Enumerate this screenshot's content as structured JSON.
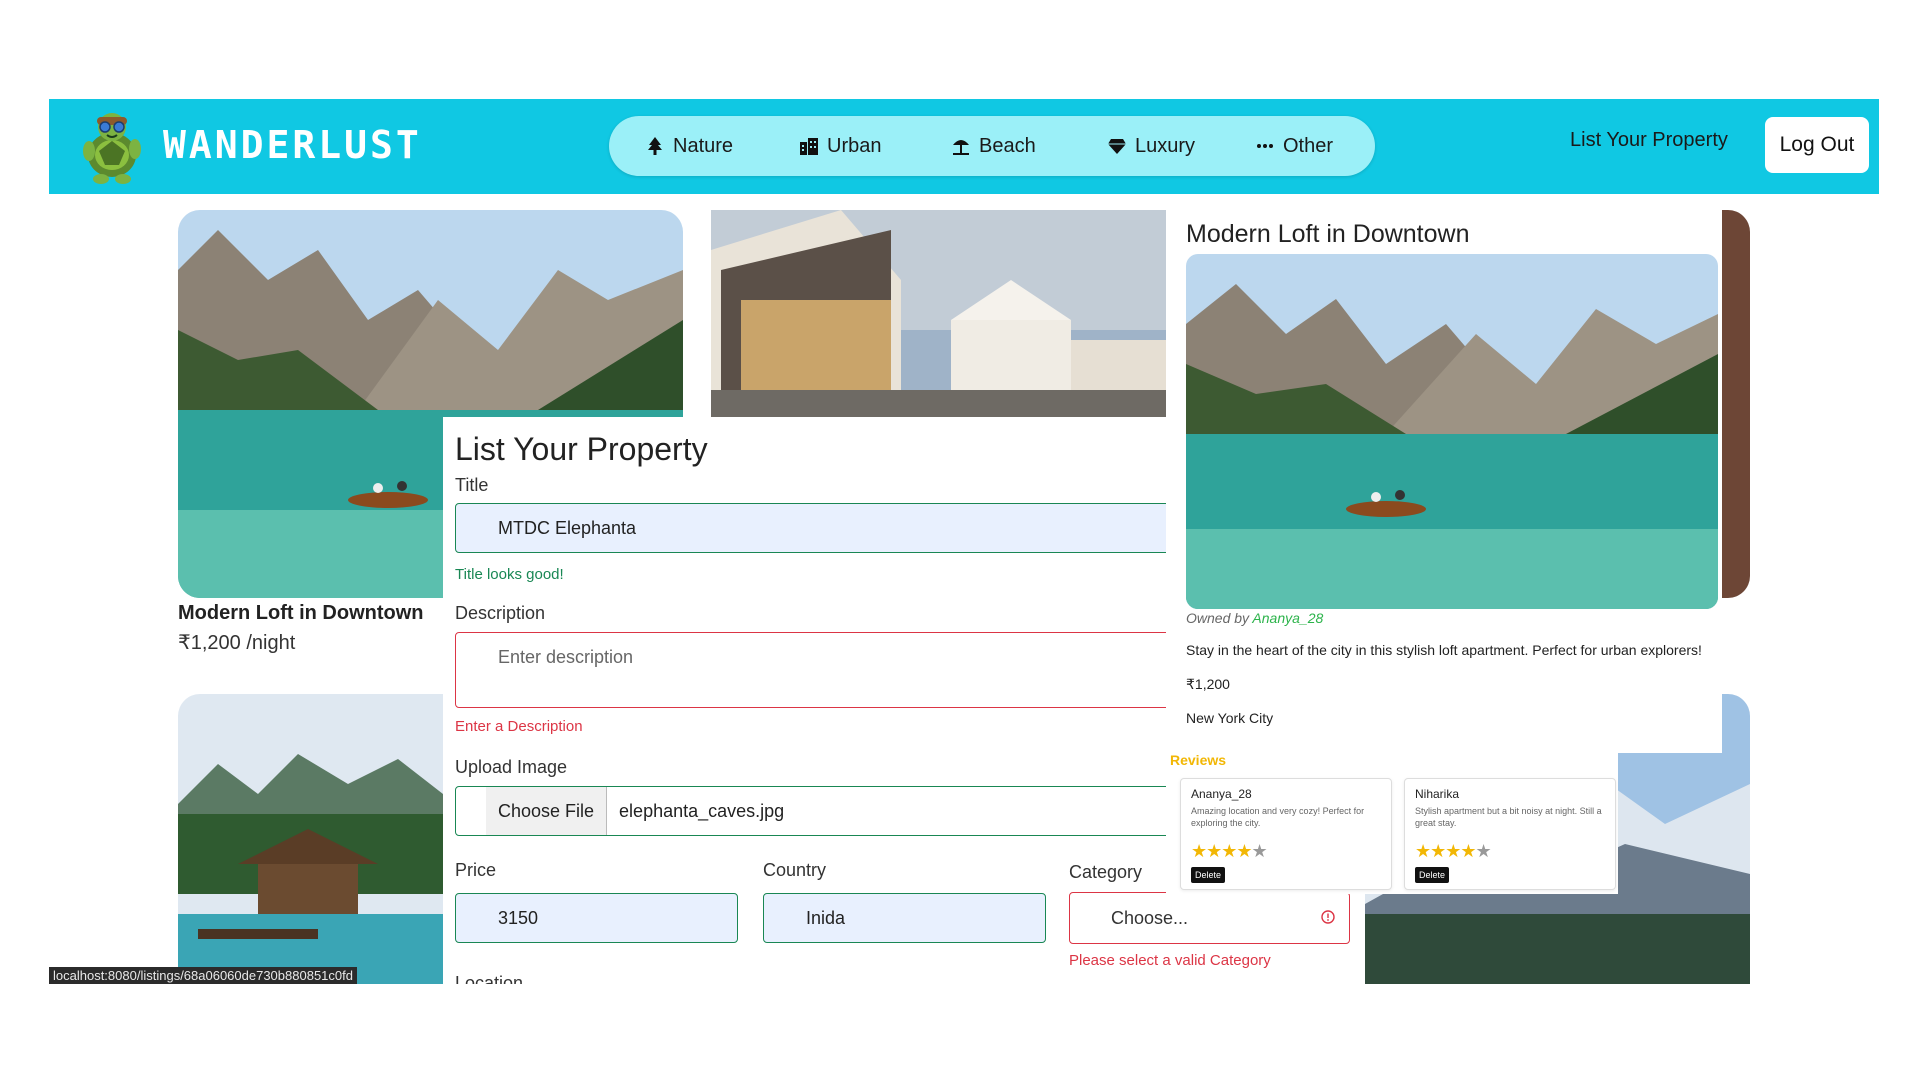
{
  "navbar": {
    "brand": "WANDERLUST",
    "categories": [
      {
        "label": "Nature",
        "icon": "tree-icon"
      },
      {
        "label": "Urban",
        "icon": "city-icon"
      },
      {
        "label": "Beach",
        "icon": "umbrella-beach-icon"
      },
      {
        "label": "Luxury",
        "icon": "gem-icon"
      },
      {
        "label": "Other",
        "icon": "ellipsis-icon"
      }
    ],
    "list_property": "List Your Property",
    "logout": "Log Out",
    "color": "#10c8e3",
    "pill_color": "#9bf0f8"
  },
  "listings": {
    "card1_title": "Modern Loft in Downtown",
    "card1_price": "₹1,200 /night"
  },
  "form": {
    "heading": "List Your Property",
    "title_label": "Title",
    "title_value": "MTDC Elephanta",
    "title_feedback": "Title looks good!",
    "description_label": "Description",
    "description_placeholder": "Enter description",
    "description_feedback": "Enter a Description",
    "upload_label": "Upload Image",
    "choose_file": "Choose File",
    "file_name": "elephanta_caves.jpg",
    "price_label": "Price",
    "price_value": "3150",
    "country_label": "Country",
    "country_value": "Inida",
    "category_label": "Category",
    "category_value": "Choose...",
    "category_feedback": "Please select a valid Category",
    "location_label": "Location"
  },
  "show": {
    "title": "Modern Loft in Downtown",
    "owned_by": "Owned by",
    "owner": "Ananya_28",
    "description": "Stay in the heart of the city in this stylish loft apartment. Perfect for urban explorers!",
    "price": "₹1,200",
    "location": "New York City"
  },
  "reviews": {
    "heading": "Reviews",
    "items": [
      {
        "author": "Ananya_28",
        "text": "Amazing location and very cozy! Perfect for exploring the city.",
        "rating": 4,
        "delete": "Delete"
      },
      {
        "author": "Niharika",
        "text": "Stylish apartment but a bit noisy at night. Still a great stay.",
        "rating": 4,
        "delete": "Delete"
      }
    ]
  },
  "status_bar": {
    "url": "localhost:8080/listings/68a06060de730b880851c0fd"
  }
}
